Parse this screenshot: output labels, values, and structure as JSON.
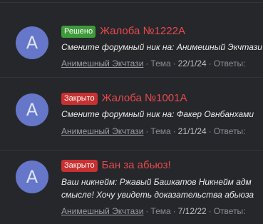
{
  "threads": [
    {
      "avatar_letter": "A",
      "badge": "Решено",
      "title": "Жалоба №1222А",
      "snippet": [
        "Смените форумный ник на: Анимешный Экчтази"
      ],
      "author": "Анимешный Экчтази",
      "type": "Тема",
      "date": "22/1/24",
      "replies_label": "Ответы:"
    },
    {
      "avatar_letter": "A",
      "badge": "Закрыто",
      "title": "Жалоба №1001А",
      "snippet": [
        "Смените форумный ник на: Факер Овнбанхами"
      ],
      "author": "Анимешный Экчтази",
      "type": "Тема",
      "date": "21/1/24",
      "replies_label": "Ответы:"
    },
    {
      "avatar_letter": "A",
      "badge": "Закрыто",
      "title": "Бан за абьюз!",
      "snippet": [
        "Ваш никнейм: Ржавый Башкатов Никнейм адм",
        "смысле! Хочу увидеть доказательства абьюза"
      ],
      "author": "Анимешный Экчтази",
      "type": "Тема",
      "date": "7/12/22",
      "replies_label": "Ответы:"
    }
  ],
  "colors": {
    "background": "#25272b",
    "title": "#e8494c",
    "badge_solved": "#3f9a3a",
    "badge_closed": "#c93030",
    "avatar": "#6677c9"
  }
}
